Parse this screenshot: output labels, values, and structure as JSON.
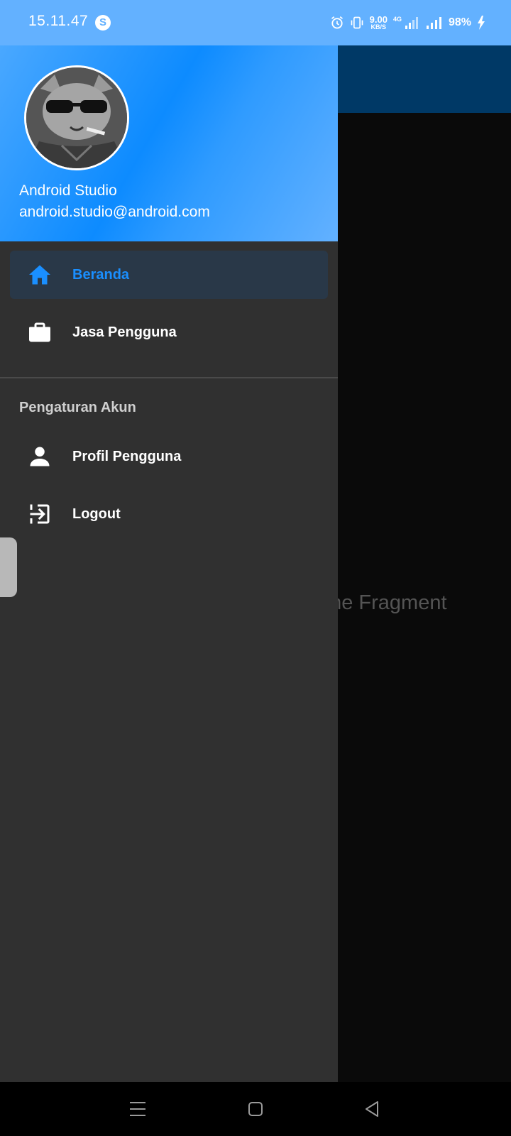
{
  "status_bar": {
    "time": "15.11.47",
    "app_icon_glyph": "S",
    "net_speed_value": "9.00",
    "net_speed_unit": "KB/S",
    "network_type": "4G",
    "battery_percent": "98%",
    "icons": [
      "alarm-icon",
      "vibrate-icon",
      "signal-4g-icon",
      "signal-icon",
      "charging-icon"
    ]
  },
  "drawer": {
    "header": {
      "user_name": "Android Studio",
      "user_email": "android.studio@android.com"
    },
    "menu": [
      {
        "label": "Beranda",
        "icon": "home-icon",
        "active": true
      },
      {
        "label": "Jasa Pengguna",
        "icon": "briefcase-icon",
        "active": false
      }
    ],
    "section_title": "Pengaturan Akun",
    "account_menu": [
      {
        "label": "Profil Pengguna",
        "icon": "person-icon"
      },
      {
        "label": "Logout",
        "icon": "logout-icon"
      }
    ]
  },
  "content": {
    "fragment_text": "Home Fragment"
  },
  "colors": {
    "accent": "#1a8fff",
    "status_bar": "#63b1ff",
    "drawer_bg": "#303030",
    "toolbar": "#003966"
  }
}
